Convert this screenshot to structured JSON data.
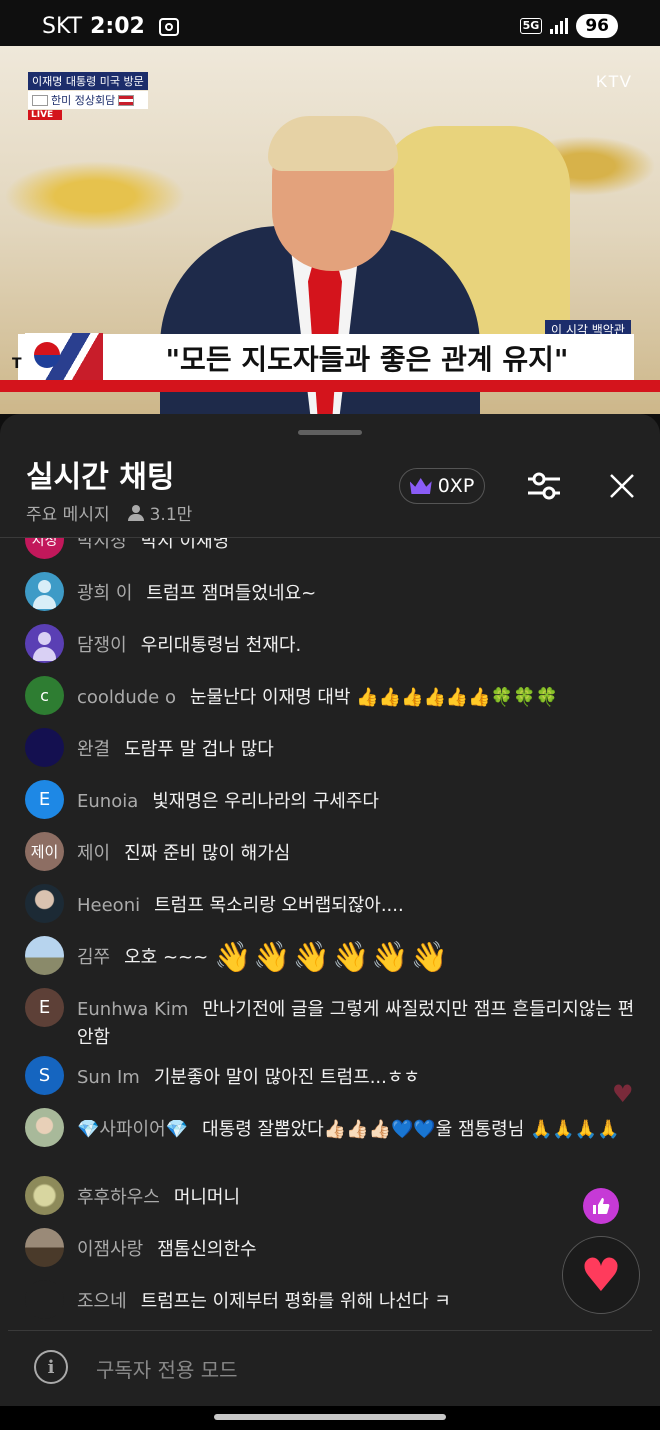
{
  "status_bar": {
    "carrier": "SKT",
    "time": "2:02",
    "network": "5G",
    "battery": "96"
  },
  "video": {
    "channel_logo": "KTV",
    "tag_line1": "이재명 대통령 미국 방문",
    "tag_line2": "한미 정상회담",
    "live_label": "LIVE",
    "sub_label": "이 시각 백악관",
    "caption": "\"모든 지도자들과 좋은 관계 유지\"",
    "caption_prefix": "T"
  },
  "chat_panel": {
    "title": "실시간 채팅",
    "mode": "주요 메시지",
    "viewer_count": "3.1만",
    "xp": "0XP"
  },
  "messages": [
    {
      "avatar": "지정",
      "avatar_color": "#c2185b",
      "name": "박지정",
      "text": "박지 이재명"
    },
    {
      "avatar": "",
      "avatar_color": "#3e9bc7",
      "name": "광희 이",
      "text": "트럼프 잼며들었네요~"
    },
    {
      "avatar": "",
      "avatar_color": "#5a3fb4",
      "name": "담쟁이",
      "text": "우리대통령님 천재다."
    },
    {
      "avatar": "c",
      "avatar_color": "#2e7d32",
      "name": "cooldude o",
      "text": "눈물난다 이재명 대박 👍👍👍👍👍👍🍀🍀🍀"
    },
    {
      "avatar": "",
      "avatar_color": "#141050",
      "name": "완결",
      "text": "도람푸 말 겁나 많다"
    },
    {
      "avatar": "E",
      "avatar_color": "#1e88e5",
      "name": "Eunoia",
      "text": "빛재명은 우리나라의 구세주다"
    },
    {
      "avatar": "제이",
      "avatar_color": "#8d6e63",
      "name": "제이",
      "text": "진짜 준비 많이 해가심"
    },
    {
      "avatar": "",
      "avatar_color": "#2c3e4a",
      "name": "Heeoni",
      "text": "트럼프 목소리랑 오버랩되잖아...."
    },
    {
      "avatar": "",
      "avatar_color": "#7fa7c9",
      "name": "김쭈",
      "text": "오호 ~~~",
      "emoji": "👋👋👋👋👋👋"
    },
    {
      "avatar": "E",
      "avatar_color": "#5d4037",
      "name": "Eunhwa Kim",
      "text": "만나기전에 글을 그렇게 싸질렀지만 잼프 흔들리지않는 편안함"
    },
    {
      "avatar": "S",
      "avatar_color": "#1565c0",
      "name": "Sun Im",
      "text": "기분좋아 말이 많아진 트럼프...ㅎㅎ"
    },
    {
      "avatar": "",
      "avatar_color": "#a8b99a",
      "name": "💎사파이어💎",
      "text": "대통령 잘뽑았다👍🏻👍🏻👍🏻💙💙울 잼통령님 🙏🙏🙏🙏"
    },
    {
      "avatar": "",
      "avatar_color": "#9c9a6a",
      "name": "후후하우스",
      "text": "머니머니"
    },
    {
      "avatar": "",
      "avatar_color": "#6b5a4a",
      "name": "이잼사랑",
      "text": "잼톰신의한수"
    },
    {
      "avatar": "",
      "avatar_color": "#212121",
      "name": "조으네",
      "text": "트럼프는 이제부터 평화를 위해 나선다 ㅋ"
    }
  ],
  "footer": {
    "text": "구독자 전용 모드"
  }
}
